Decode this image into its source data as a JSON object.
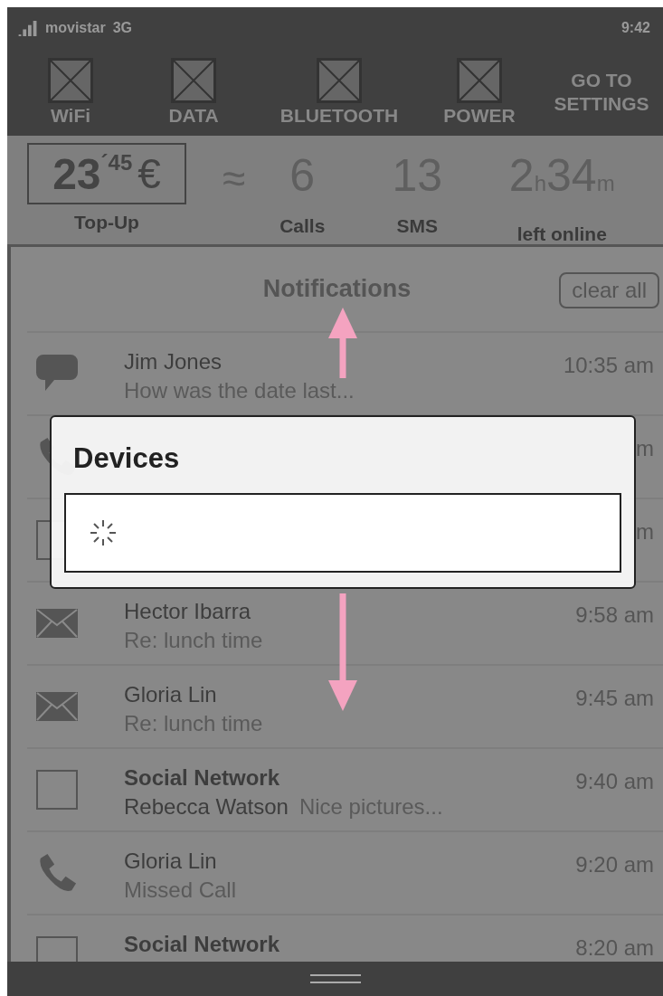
{
  "status_bar": {
    "carrier": "movistar",
    "network": "3G",
    "time": "9:42"
  },
  "toggles": [
    {
      "label": "WiFi"
    },
    {
      "label": "DATA"
    },
    {
      "label": "BLUETOOTH"
    },
    {
      "label": "POWER"
    }
  ],
  "settings_button": "GO TO SETTINGS",
  "balance": {
    "amount": "23",
    "cents": "´45",
    "currency": "€",
    "label": "Top-Up"
  },
  "approx": "≈",
  "stats": [
    {
      "value": "6",
      "label": "Calls"
    },
    {
      "value": "13",
      "label": "SMS"
    },
    {
      "value": "2$_{h}$34$_{m}$",
      "label": "left online"
    }
  ],
  "notifications": {
    "title": "Notifications",
    "clear_button": "clear all",
    "items": [
      {
        "kind": "chat",
        "title": "Jim Jones",
        "subtitle": "How was the date last...",
        "time": "10:35 am"
      },
      {
        "kind": "call",
        "time": "m"
      },
      {
        "kind": "social",
        "time": "m"
      },
      {
        "kind": "email",
        "title": "Hector Ibarra",
        "subtitle": "Re: lunch time",
        "time": "9:58 am"
      },
      {
        "kind": "email",
        "title": "Gloria Lin",
        "subtitle": "Re: lunch time",
        "time": "9:45 am"
      },
      {
        "kind": "social",
        "title": "Social Network",
        "subtitle": "Rebecca Watson",
        "detail": "Nice pictures...",
        "time": "9:40 am"
      },
      {
        "kind": "call",
        "title": "Gloria Lin",
        "subtitle": "Missed Call",
        "time": "9:20 am"
      },
      {
        "kind": "social",
        "title": "Social Network",
        "time": "8:20 am"
      }
    ]
  },
  "dialog": {
    "title": "Devices",
    "loading": true
  }
}
